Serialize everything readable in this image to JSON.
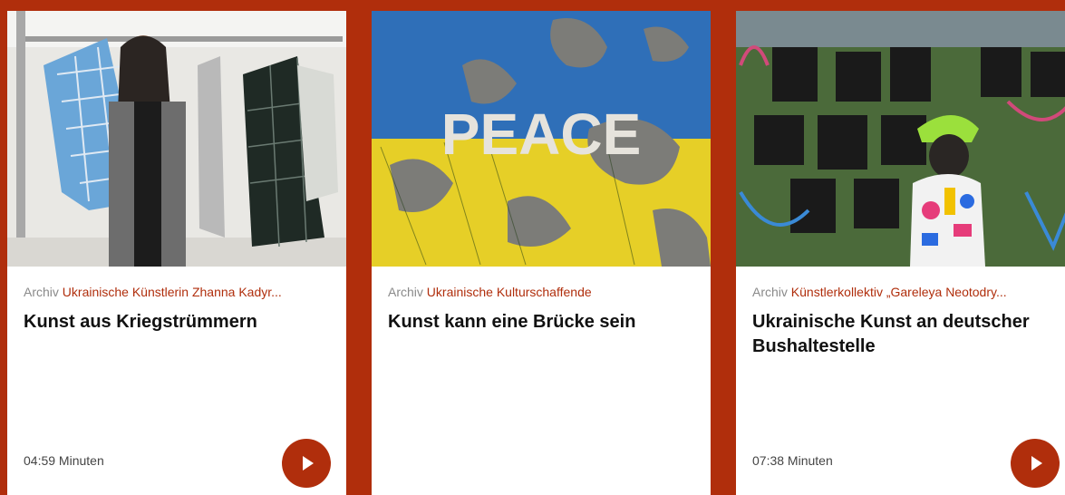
{
  "cards": [
    {
      "image": "artist-with-tile-coats-photo",
      "archive_label": "Archiv",
      "kicker": "Ukrainische Künstlerin Zhanna Kadyr...",
      "title": "Kunst aus Kriegstrümmern",
      "duration": "04:59 Minuten",
      "has_play": true
    },
    {
      "image": "peace-wall-ukraine-flag-photo",
      "archive_label": "Archiv",
      "kicker": "Ukrainische Kulturschaffende",
      "title": "Kunst kann eine Brücke sein",
      "duration": "",
      "has_play": false
    },
    {
      "image": "graffiti-wall-woman-photo",
      "archive_label": "Archiv",
      "kicker": "Künstlerkollektiv „Gareleya Neotodry...",
      "title": "Ukrainische Kunst an deutscher Bushaltestelle",
      "duration": "07:38 Minuten",
      "has_play": true
    }
  ],
  "image_text": "PEACE",
  "colors": {
    "accent": "#b02e0c",
    "muted": "#8a8a8a"
  },
  "icons": {
    "play": "play-icon"
  }
}
